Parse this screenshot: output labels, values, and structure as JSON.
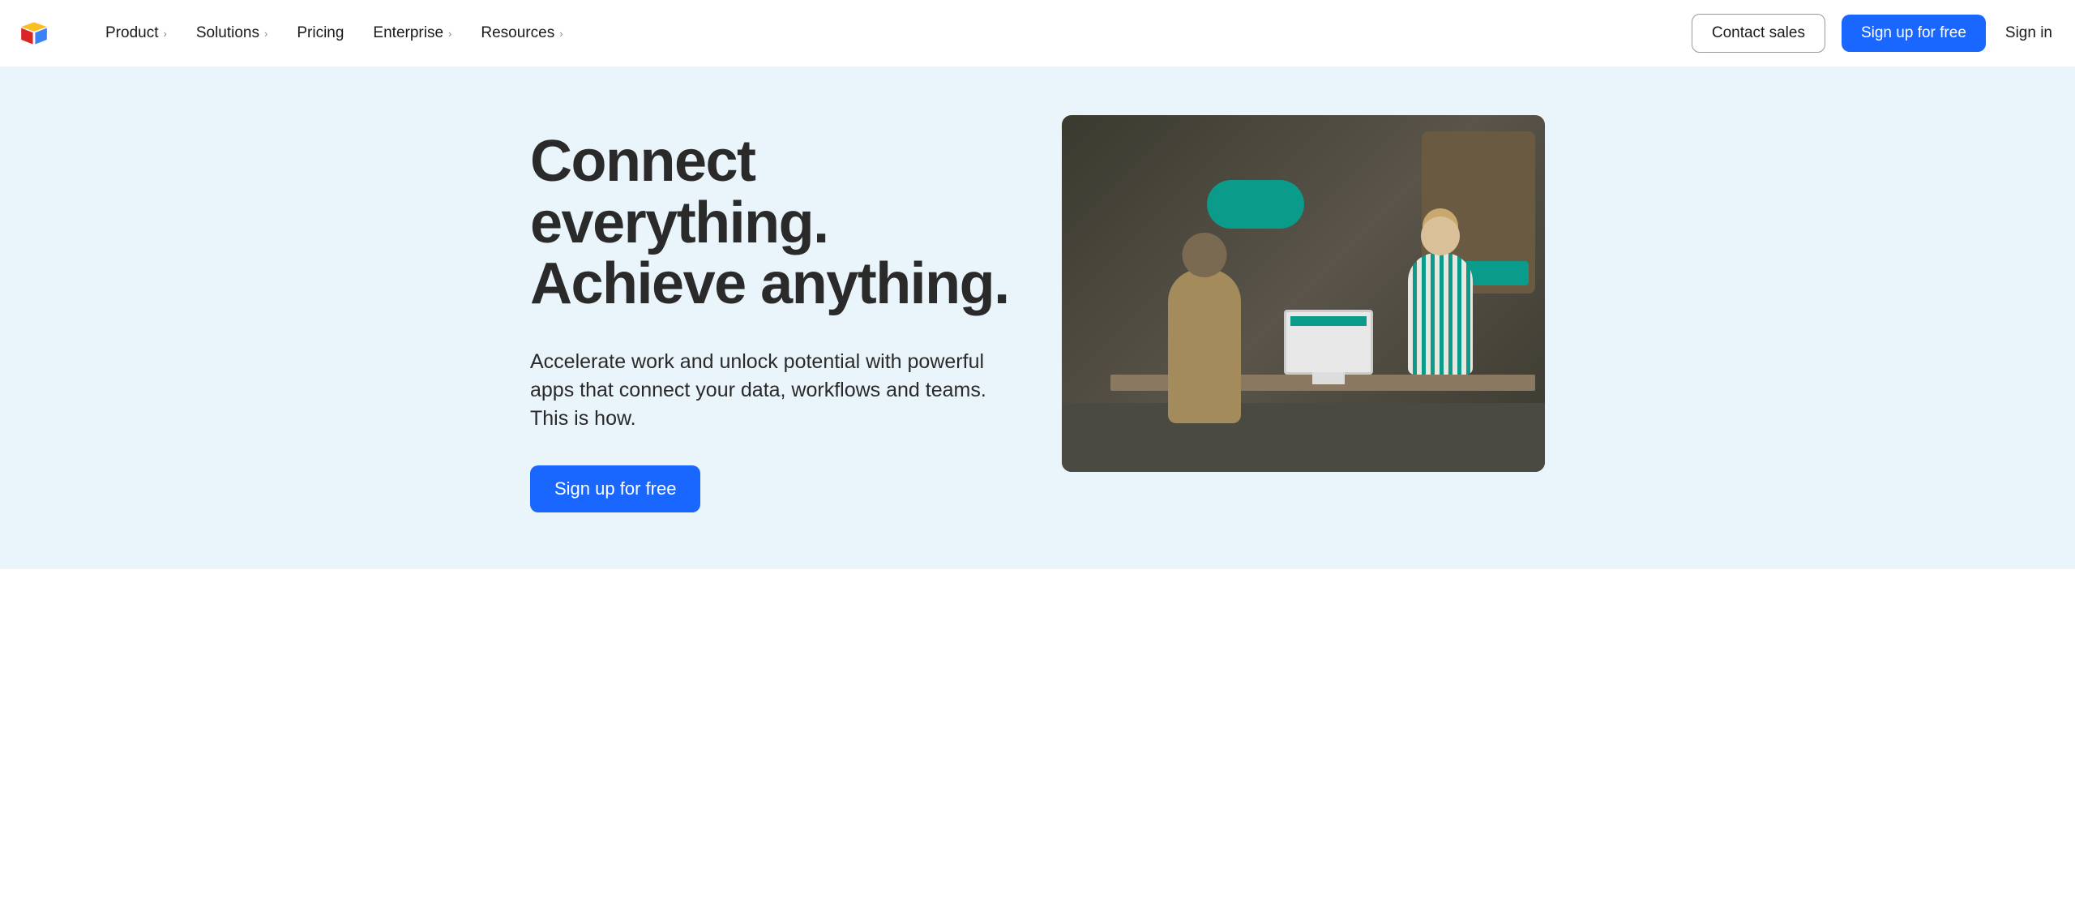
{
  "nav": {
    "items": [
      {
        "label": "Product",
        "hasDropdown": true
      },
      {
        "label": "Solutions",
        "hasDropdown": true
      },
      {
        "label": "Pricing",
        "hasDropdown": false
      },
      {
        "label": "Enterprise",
        "hasDropdown": true
      },
      {
        "label": "Resources",
        "hasDropdown": true
      }
    ]
  },
  "header": {
    "contact": "Contact sales",
    "signup": "Sign up for free",
    "signin": "Sign in"
  },
  "hero": {
    "title": "Connect everything. Achieve anything.",
    "subtitle": "Accelerate work and unlock potential with powerful apps that connect your data, workflows and teams. This is how.",
    "cta": "Sign up for free"
  }
}
